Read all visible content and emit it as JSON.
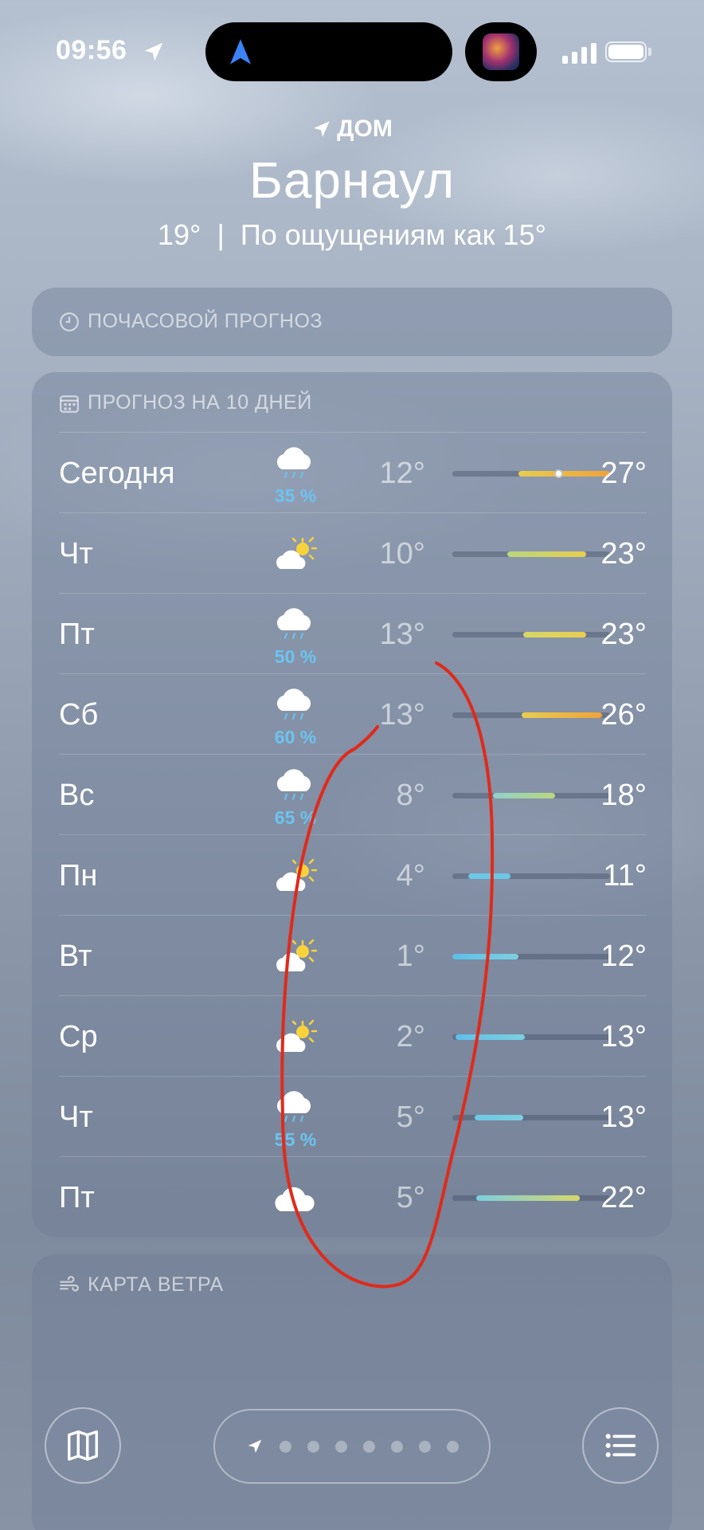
{
  "status_bar": {
    "time": "09:56"
  },
  "header": {
    "location_label": "ДОМ",
    "city": "Барнаул",
    "current_temp": "19°",
    "separator": "|",
    "feels_like": "По ощущениям как 15°"
  },
  "hourly": {
    "title": "ПОЧАСОВОЙ ПРОГНОЗ"
  },
  "forecast": {
    "title": "ПРОГНОЗ НА 10 ДНЕЙ",
    "days": [
      {
        "day": "Сегодня",
        "icon": "rain-cloud-icon",
        "precip": "35 %",
        "lo": "12°",
        "hi": "27°",
        "range": [
          0.42,
          1.0
        ],
        "colors": [
          "#e8cd4e",
          "#f0a23a"
        ],
        "current_marker": 0.67
      },
      {
        "day": "Чт",
        "icon": "partly-sunny-icon",
        "precip": "",
        "lo": "10°",
        "hi": "23°",
        "range": [
          0.35,
          0.85
        ],
        "colors": [
          "#b9d67e",
          "#e8cd4e"
        ]
      },
      {
        "day": "Пт",
        "icon": "rain-cloud-icon",
        "precip": "50 %",
        "lo": "13°",
        "hi": "23°",
        "range": [
          0.45,
          0.85
        ],
        "colors": [
          "#d6d768",
          "#e8cd4e"
        ]
      },
      {
        "day": "Сб",
        "icon": "rain-cloud-icon",
        "precip": "60 %",
        "lo": "13°",
        "hi": "26°",
        "range": [
          0.44,
          0.95
        ],
        "colors": [
          "#e8cd4e",
          "#f0a23a"
        ]
      },
      {
        "day": "Вс",
        "icon": "rain-cloud-icon",
        "precip": "65 %",
        "lo": "8°",
        "hi": "18°",
        "range": [
          0.26,
          0.65
        ],
        "colors": [
          "#8fd2c9",
          "#b9d67e"
        ]
      },
      {
        "day": "Пн",
        "icon": "partly-sunny-icon",
        "precip": "",
        "lo": "4°",
        "hi": "11°",
        "range": [
          0.1,
          0.37
        ],
        "colors": [
          "#6cc8e6",
          "#6cc8e6"
        ]
      },
      {
        "day": "Вт",
        "icon": "partly-sunny-icon",
        "precip": "",
        "lo": "1°",
        "hi": "12°",
        "range": [
          0.0,
          0.42
        ],
        "colors": [
          "#5ebfe8",
          "#7ccfe0"
        ]
      },
      {
        "day": "Ср",
        "icon": "partly-sunny-icon",
        "precip": "",
        "lo": "2°",
        "hi": "13°",
        "range": [
          0.02,
          0.46
        ],
        "colors": [
          "#5ebfe8",
          "#7ccfe0"
        ]
      },
      {
        "day": "Чт",
        "icon": "rain-cloud-icon",
        "precip": "55 %",
        "lo": "5°",
        "hi": "13°",
        "range": [
          0.14,
          0.45
        ],
        "colors": [
          "#6cc8e6",
          "#7ccfe0"
        ]
      },
      {
        "day": "Пт",
        "icon": "cloud-icon",
        "precip": "",
        "lo": "5°",
        "hi": "22°",
        "range": [
          0.15,
          0.81
        ],
        "colors": [
          "#7ccfe0",
          "#d6d768"
        ]
      }
    ]
  },
  "wind_map": {
    "title": "КАРТА ВЕТРА"
  },
  "pager": {
    "dot_count": 7
  }
}
